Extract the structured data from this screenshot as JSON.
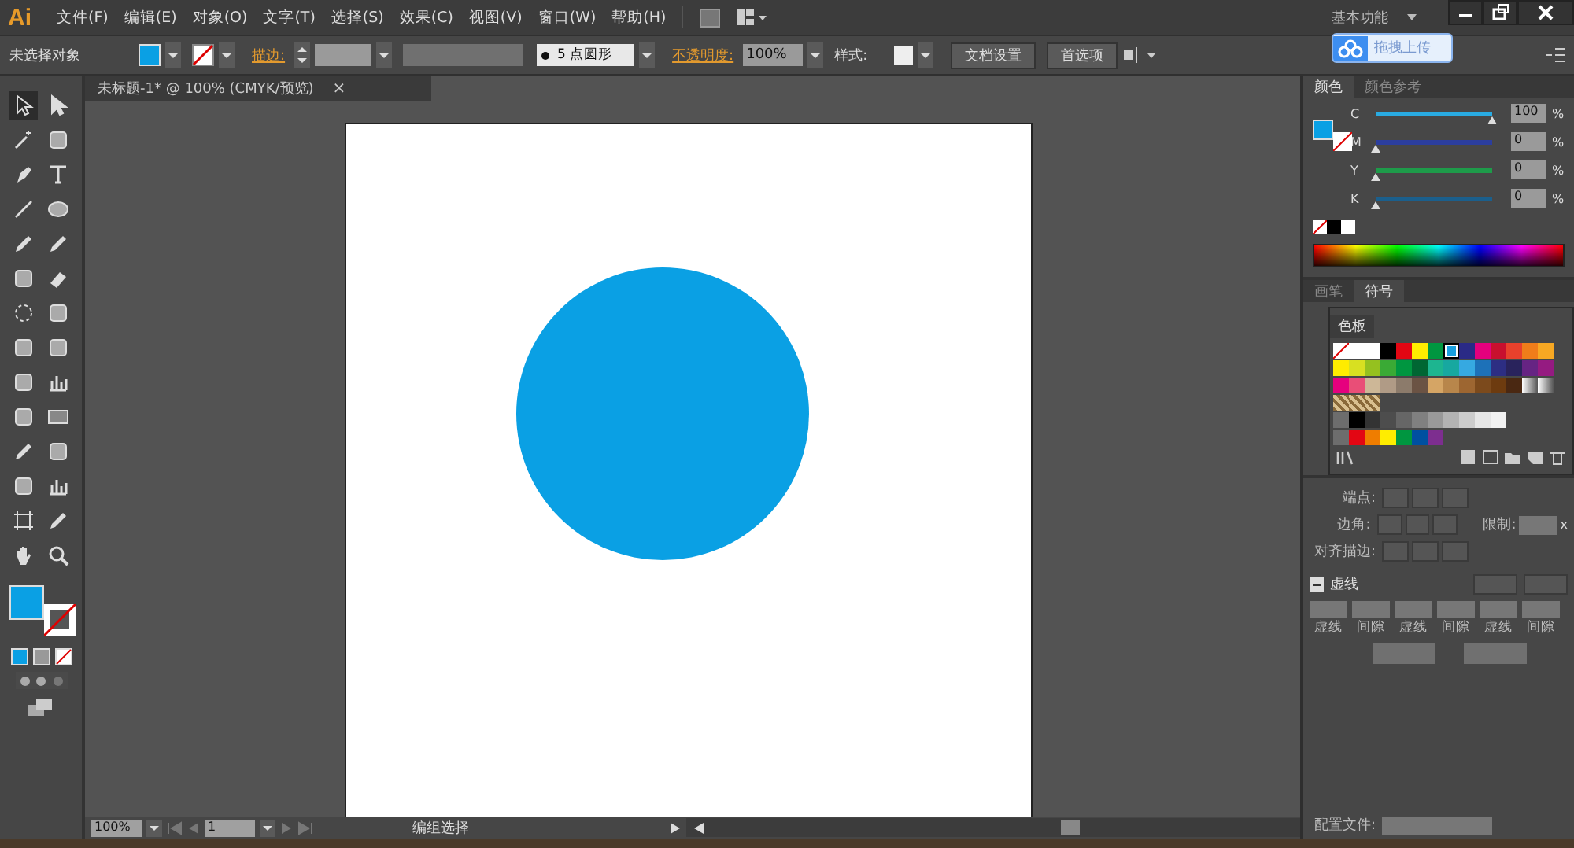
{
  "app": {
    "logo": "Ai",
    "menu": [
      "文件(F)",
      "编辑(E)",
      "对象(O)",
      "文字(T)",
      "选择(S)",
      "效果(C)",
      "视图(V)",
      "窗口(W)",
      "帮助(H)"
    ],
    "workspace": "基本功能"
  },
  "upload_badge": {
    "label": "拖拽上传"
  },
  "control_bar": {
    "selection": "未选择对象",
    "stroke_label": "描边:",
    "brush": "5 点圆形",
    "opacity_label": "不透明度:",
    "opacity": "100%",
    "style_label": "样式:",
    "buttons": [
      "文档设置",
      "首选项"
    ]
  },
  "document_tab": {
    "title": "未标题-1* @ 100% (CMYK/预览)",
    "close": "×"
  },
  "color_panel": {
    "tabs": [
      {
        "label": "颜色",
        "selected": true
      },
      {
        "label": "颜色参考",
        "selected": false
      }
    ],
    "sliders": [
      {
        "label": "C",
        "level": 1,
        "value": "100",
        "unit": "%",
        "color": "#29abe2"
      },
      {
        "label": "M",
        "level": 0,
        "value": "0",
        "unit": "%",
        "color": "#2c3e9e"
      },
      {
        "label": "Y",
        "level": 0,
        "value": "0",
        "unit": "%",
        "color": "#1e9b4a"
      },
      {
        "label": "K",
        "level": 0,
        "value": "0",
        "unit": "%",
        "color": "#1b5f8c"
      }
    ]
  },
  "symbols_panel": {
    "tabs": [
      {
        "label": "画笔",
        "selected": false
      },
      {
        "label": "符号",
        "selected": true
      }
    ]
  },
  "swatches_panel": {
    "title": "色板",
    "rows": [
      [
        {
          "kind": "none",
          "selected": false
        },
        {
          "kind": "registration",
          "selected": false
        },
        {
          "kind": "color",
          "color": "#ffffff",
          "selected": false
        },
        {
          "kind": "color",
          "color": "#000000",
          "selected": false
        },
        {
          "kind": "color",
          "color": "#e30613",
          "selected": false
        },
        {
          "kind": "color",
          "color": "#ffed00",
          "selected": false
        },
        {
          "kind": "color",
          "color": "#009640",
          "selected": false
        },
        {
          "kind": "color",
          "color": "#1aa0e0",
          "selected": true
        },
        {
          "kind": "color",
          "color": "#2a2a86",
          "selected": false
        },
        {
          "kind": "color",
          "color": "#e5007d",
          "selected": false
        },
        {
          "kind": "color",
          "color": "#c8102e",
          "selected": false
        },
        {
          "kind": "color",
          "color": "#e8412c",
          "selected": false
        },
        {
          "kind": "color",
          "color": "#ef7d1a",
          "selected": false
        },
        {
          "kind": "color",
          "color": "#f7a823",
          "selected": false
        }
      ],
      [
        {
          "kind": "color",
          "color": "#ffec00",
          "selected": false
        },
        {
          "kind": "color",
          "color": "#d8e021",
          "selected": false
        },
        {
          "kind": "color",
          "color": "#95c11f",
          "selected": false
        },
        {
          "kind": "color",
          "color": "#3aaa35",
          "selected": false
        },
        {
          "kind": "color",
          "color": "#009640",
          "selected": false
        },
        {
          "kind": "color",
          "color": "#006633",
          "selected": false
        },
        {
          "kind": "color",
          "color": "#1db590",
          "selected": false
        },
        {
          "kind": "color",
          "color": "#17a8a0",
          "selected": false
        },
        {
          "kind": "color",
          "color": "#36a9e1",
          "selected": false
        },
        {
          "kind": "color",
          "color": "#1d71b8",
          "selected": false
        },
        {
          "kind": "color",
          "color": "#2d2e83",
          "selected": false
        },
        {
          "kind": "color",
          "color": "#29235c",
          "selected": false
        },
        {
          "kind": "color",
          "color": "#662483",
          "selected": false
        },
        {
          "kind": "color",
          "color": "#951b81",
          "selected": false
        }
      ],
      [
        {
          "kind": "color",
          "color": "#e6007e",
          "selected": false
        },
        {
          "kind": "color",
          "color": "#e94e77",
          "selected": false
        },
        {
          "kind": "color",
          "color": "#cdb797",
          "selected": false
        },
        {
          "kind": "color",
          "color": "#b09b86",
          "selected": false
        },
        {
          "kind": "color",
          "color": "#8c7b6b",
          "selected": false
        },
        {
          "kind": "color",
          "color": "#6b5344",
          "selected": false
        },
        {
          "kind": "color",
          "color": "#d5a565",
          "selected": false
        },
        {
          "kind": "color",
          "color": "#b8864b",
          "selected": false
        },
        {
          "kind": "color",
          "color": "#9d6631",
          "selected": false
        },
        {
          "kind": "color",
          "color": "#7c4a1c",
          "selected": false
        },
        {
          "kind": "color",
          "color": "#6d3b0f",
          "selected": false
        },
        {
          "kind": "color",
          "color": "#4a2812",
          "selected": false
        },
        {
          "kind": "gradient",
          "selected": false
        },
        {
          "kind": "gradient",
          "selected": false
        }
      ],
      [
        {
          "kind": "pattern",
          "selected": false
        },
        {
          "kind": "pattern",
          "selected": false
        },
        {
          "kind": "pattern",
          "selected": false
        }
      ],
      [
        {
          "kind": "folder",
          "selected": false
        },
        {
          "kind": "color",
          "color": "#000000",
          "selected": false
        },
        {
          "kind": "color",
          "color": "#333333",
          "selected": false
        },
        {
          "kind": "color",
          "color": "#4d4d4d",
          "selected": false
        },
        {
          "kind": "color",
          "color": "#666666",
          "selected": false
        },
        {
          "kind": "color",
          "color": "#808080",
          "selected": false
        },
        {
          "kind": "color",
          "color": "#999999",
          "selected": false
        },
        {
          "kind": "color",
          "color": "#b3b3b3",
          "selected": false
        },
        {
          "kind": "color",
          "color": "#cccccc",
          "selected": false
        },
        {
          "kind": "color",
          "color": "#e6e6e6",
          "selected": false
        },
        {
          "kind": "color",
          "color": "#f2f2f2",
          "selected": false
        }
      ],
      [
        {
          "kind": "folder",
          "selected": false
        },
        {
          "kind": "color",
          "color": "#e30613",
          "selected": false
        },
        {
          "kind": "color",
          "color": "#ef7d00",
          "selected": false
        },
        {
          "kind": "color",
          "color": "#ffed00",
          "selected": false
        },
        {
          "kind": "color",
          "color": "#009640",
          "selected": false
        },
        {
          "kind": "color",
          "color": "#0050a0",
          "selected": false
        },
        {
          "kind": "color",
          "color": "#7d2e8f",
          "selected": false
        }
      ]
    ]
  },
  "stroke_panel": {
    "cap_label": "端点:",
    "corner_label": "边角:",
    "limit_label": "限制:",
    "limit_unit": "x",
    "align_label": "对齐描边:",
    "dash_title": "虚线",
    "dash_fields": [
      "虚线",
      "间隙",
      "虚线",
      "间隙",
      "虚线",
      "间隙"
    ],
    "profile_label": "配置文件:"
  },
  "status_bar": {
    "zoom": "100%",
    "page": "1",
    "status": "编组选择"
  }
}
